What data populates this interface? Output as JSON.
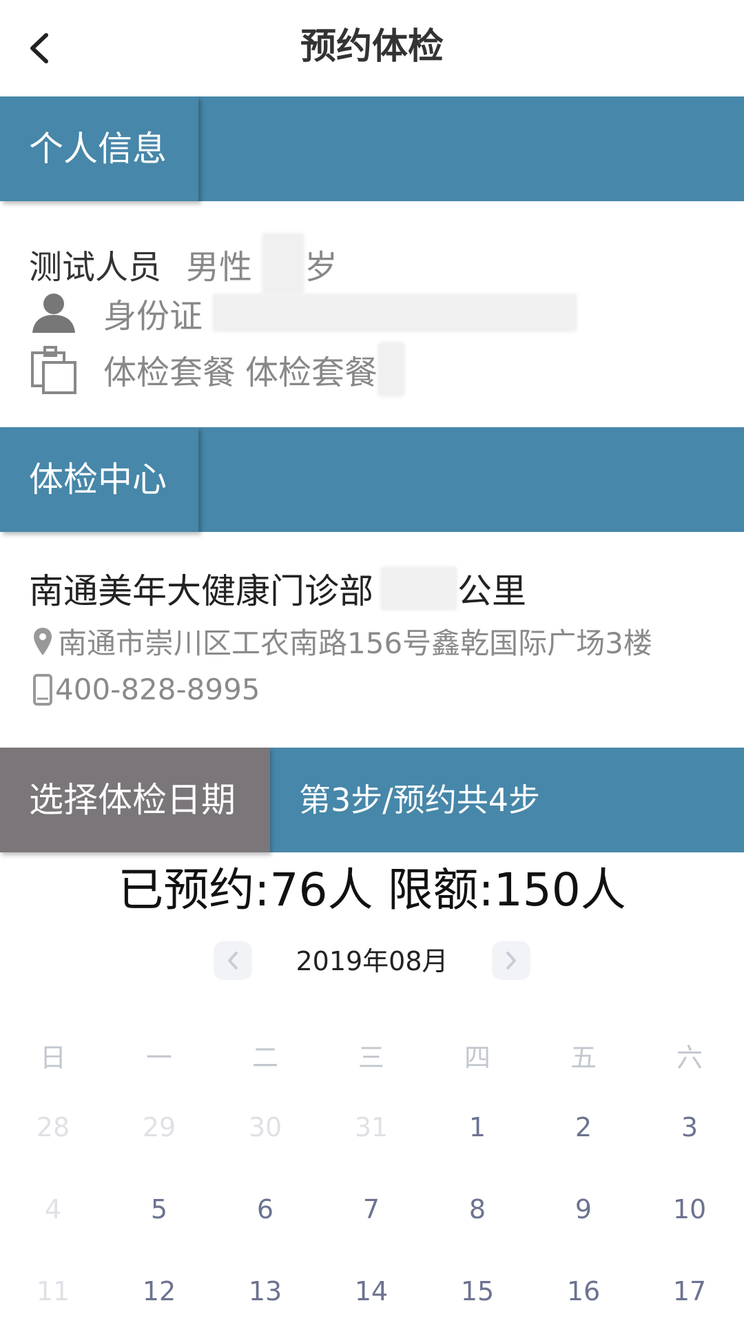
{
  "header": {
    "title": "预约体检"
  },
  "personal": {
    "section_title": "个人信息",
    "name": "测试人员",
    "gender": "男性",
    "age_unit": "岁",
    "id_label": "身份证",
    "package_label": "体检套餐",
    "package_value": "体检套餐"
  },
  "center": {
    "section_title": "体检中心",
    "name": "南通美年大健康门诊部",
    "distance_unit": "公里",
    "address": "南通市崇川区工农南路156号鑫乾国际广场3楼",
    "phone": "400-828-8995"
  },
  "date_step": {
    "section_title": "选择体检日期",
    "step_text": "第3步/预约共4步"
  },
  "quota": {
    "text": "已预约:76人 限额:150人"
  },
  "calendar": {
    "month": "2019年08月",
    "weekdays": [
      "日",
      "一",
      "二",
      "三",
      "四",
      "五",
      "六"
    ],
    "weeks": [
      [
        "28",
        "29",
        "30",
        "31",
        "1",
        "2",
        "3"
      ],
      [
        "4",
        "5",
        "6",
        "7",
        "8",
        "9",
        "10"
      ],
      [
        "11",
        "12",
        "13",
        "14",
        "15",
        "16",
        "17"
      ]
    ]
  },
  "colors": {
    "section_blue": "#4787a9",
    "section_grey": "#7b7679",
    "day_active": "#6c7390",
    "day_disabled": "#dfe1e6"
  }
}
